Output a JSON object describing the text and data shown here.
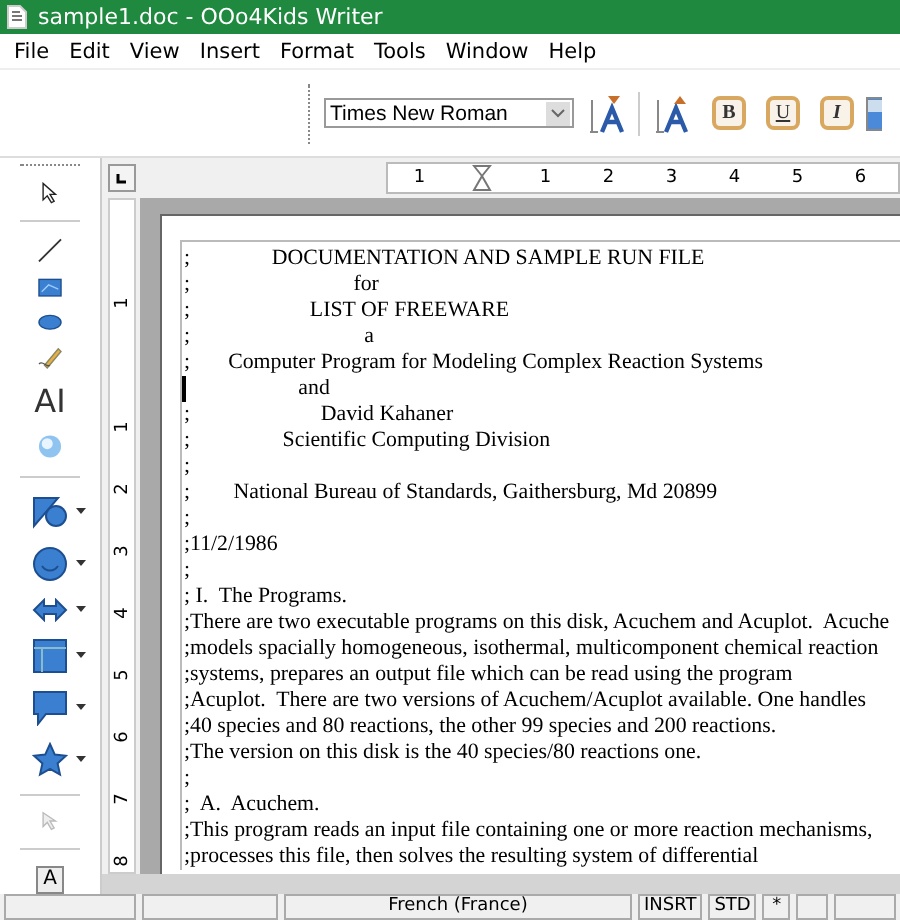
{
  "window": {
    "title": "sample1.doc - OOo4Kids Writer"
  },
  "menu": [
    "File",
    "Edit",
    "View",
    "Insert",
    "Format",
    "Tools",
    "Window",
    "Help"
  ],
  "toolbar": {
    "font_name": "Times New Roman",
    "bold": "B",
    "underline": "U",
    "italic": "I"
  },
  "drawing_toolbar": {
    "fontwork_text": "AI",
    "text_box": "A"
  },
  "horizontal_ruler": [
    "1",
    "1",
    "2",
    "3",
    "4",
    "5",
    "6"
  ],
  "vertical_ruler": [
    "1",
    "1",
    "2",
    "3",
    "4",
    "5",
    "6",
    "7",
    "8"
  ],
  "document_lines": [
    {
      "text": ";               DOCUMENTATION AND SAMPLE RUN FILE",
      "cursor": false
    },
    {
      "text": ";                              for",
      "cursor": false
    },
    {
      "text": ";                      LIST OF FREEWARE",
      "cursor": false
    },
    {
      "text": ";                                a",
      "cursor": false
    },
    {
      "text": ";       Computer Program for Modeling Complex Reaction Systems",
      "cursor": false
    },
    {
      "text": "                     and",
      "cursor": true
    },
    {
      "text": ";                        David Kahaner",
      "cursor": false
    },
    {
      "text": ";                 Scientific Computing Division",
      "cursor": false
    },
    {
      "text": ";",
      "cursor": false
    },
    {
      "text": ";        National Bureau of Standards, Gaithersburg, Md 20899",
      "cursor": false
    },
    {
      "text": ";",
      "cursor": false
    },
    {
      "text": ";11/2/1986",
      "cursor": false
    },
    {
      "text": ";",
      "cursor": false
    },
    {
      "text": "; I.  The Programs.",
      "cursor": false
    },
    {
      "text": ";There are two executable programs on this disk, Acuchem and Acuplot.  Acuche",
      "cursor": false
    },
    {
      "text": ";models spacially homogeneous, isothermal, multicomponent chemical reaction",
      "cursor": false
    },
    {
      "text": ";systems, prepares an output file which can be read using the program",
      "cursor": false
    },
    {
      "text": ";Acuplot.  There are two versions of Acuchem/Acuplot available. One handles",
      "cursor": false
    },
    {
      "text": ";40 species and 80 reactions, the other 99 species and 200 reactions.",
      "cursor": false
    },
    {
      "text": ";The version on this disk is the 40 species/80 reactions one.",
      "cursor": false
    },
    {
      "text": ";",
      "cursor": false
    },
    {
      "text": ";  A.  Acuchem.",
      "cursor": false
    },
    {
      "text": ";This program reads an input file containing one or more reaction mechanisms,",
      "cursor": false
    },
    {
      "text": ";processes this file, then solves the resulting system of differential",
      "cursor": false
    }
  ],
  "status_bar": [
    "French (France)",
    "INSRT",
    "STD",
    "*"
  ]
}
